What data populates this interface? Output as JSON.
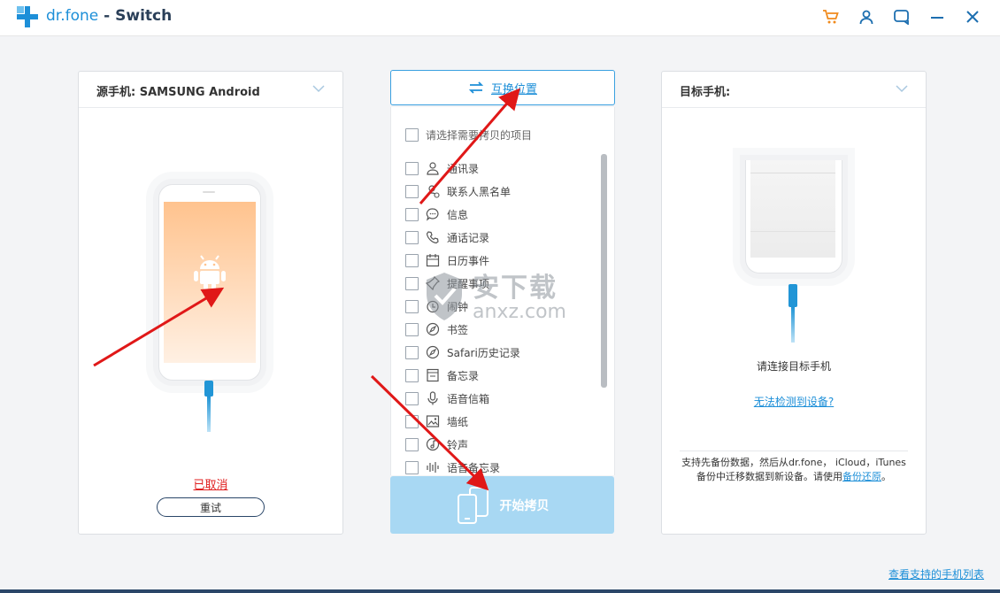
{
  "app": {
    "brand": "dr.fone",
    "separator": " - ",
    "module": "Switch"
  },
  "window_icons": [
    "cart-icon",
    "user-icon",
    "feedback-icon",
    "minimize-icon",
    "close-icon"
  ],
  "source": {
    "header": "源手机: SAMSUNG Android",
    "status": "已取消",
    "retry_label": "重试"
  },
  "middle": {
    "swap_label": "互换位置",
    "select_all_label": "请选择需要拷贝的项目",
    "items": [
      {
        "label": "通讯录",
        "icon": "contacts-icon"
      },
      {
        "label": "联系人黑名单",
        "icon": "blocked-contacts-icon"
      },
      {
        "label": "信息",
        "icon": "message-icon"
      },
      {
        "label": "通话记录",
        "icon": "call-log-icon"
      },
      {
        "label": "日历事件",
        "icon": "calendar-icon"
      },
      {
        "label": "提醒事项",
        "icon": "reminder-icon"
      },
      {
        "label": "闹钟",
        "icon": "alarm-icon"
      },
      {
        "label": "书签",
        "icon": "bookmark-icon"
      },
      {
        "label": "Safari历史记录",
        "icon": "safari-icon"
      },
      {
        "label": "备忘录",
        "icon": "notes-icon"
      },
      {
        "label": "语音信箱",
        "icon": "voicemail-icon"
      },
      {
        "label": "墙纸",
        "icon": "wallpaper-icon"
      },
      {
        "label": "铃声",
        "icon": "ringtone-icon"
      },
      {
        "label": "语音备忘录",
        "icon": "voice-memo-icon"
      }
    ],
    "start_label": "开始拷贝"
  },
  "target": {
    "header": "目标手机:",
    "connect_text": "请连接目标手机",
    "detect_link": "无法检测到设备?",
    "info_prefix": "支持先备份数据，然后从dr.fone， iCloud，iTunes备份中迁移数据到新设备。请使用",
    "info_link": "备份还原",
    "info_suffix": "。"
  },
  "footer": {
    "phones_link": "查看支持的手机列表"
  },
  "watermark": {
    "line1": "安下载",
    "line2": "anxz.com"
  },
  "colors": {
    "accent": "#1d8fd8",
    "start_button": "#a8d8f3",
    "cancel_red": "#e02020",
    "annotation_arrow": "#e01818",
    "dark_line": "#2a4668"
  }
}
